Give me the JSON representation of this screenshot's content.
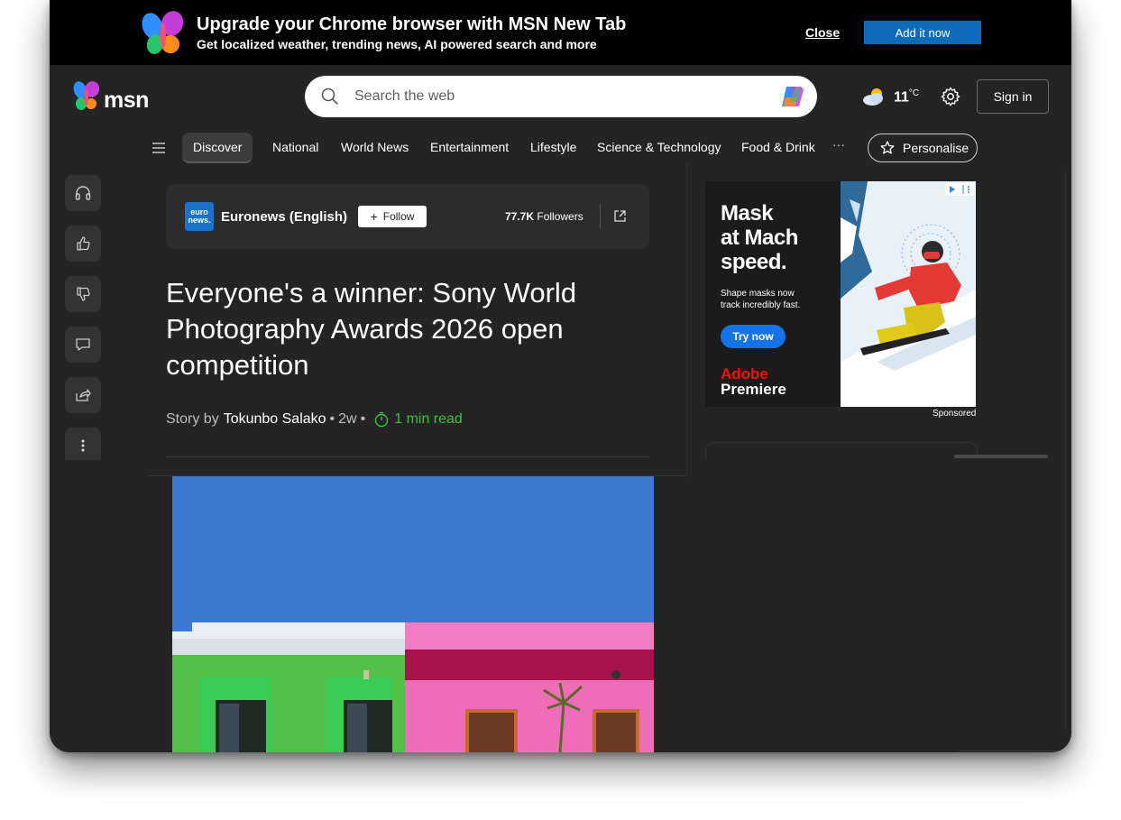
{
  "banner": {
    "title": "Upgrade your Chrome browser with MSN New Tab",
    "subtitle": "Get localized weather, trending news, AI powered search and more",
    "close_label": "Close",
    "add_label": "Add it now"
  },
  "header": {
    "brand": "msn",
    "search_placeholder": "Search the web",
    "temperature": "11",
    "temperature_unit": "°C",
    "weather_icon": "partly-cloudy-icon",
    "signin_label": "Sign in"
  },
  "nav": {
    "items": [
      "Discover",
      "National",
      "World News",
      "Entertainment",
      "Lifestyle",
      "Science & Technology",
      "Food & Drink"
    ],
    "more": "···",
    "personalise_label": "Personalise"
  },
  "rail": {
    "icons": [
      "headphones-icon",
      "thumbs-up-icon",
      "thumbs-down-icon",
      "comment-icon",
      "share-icon",
      "more-vertical-icon"
    ]
  },
  "article": {
    "source_logo_line1": "euro",
    "source_logo_line2": "news.",
    "source_name": "Euronews (English)",
    "follow_label": "Follow",
    "followers_count": "77.7K",
    "followers_label": "Followers",
    "headline": "Everyone's a winner: Sony World Photography Awards 2026 open competition",
    "story_by": "Story by",
    "author": "Tokunbo Salako",
    "age": "2w",
    "sep": "•",
    "read_time": "1 min read"
  },
  "ad": {
    "headline_line1": "Mask",
    "headline_line2": "at Mach",
    "headline_line3": "speed.",
    "body_line1": "Shape masks now",
    "body_line2": "track incredibly fast.",
    "cta": "Try now",
    "brand_line1": "Adobe",
    "brand_line2": "Premiere",
    "sponsored": "Sponsored"
  },
  "colors": {
    "background": "#242424",
    "banner": "#000000",
    "accent_button": "#0f6cbd",
    "read_time": "#3ec13e",
    "adobe_red": "#fa0f00"
  }
}
